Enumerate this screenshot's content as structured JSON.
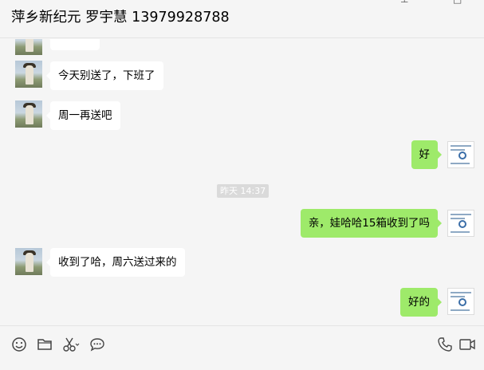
{
  "window": {
    "title": "萍乡新纪元 罗宇慧 13979928788",
    "controls": {
      "pin": "⊥",
      "minimize": "—",
      "maximize": "□"
    }
  },
  "messages": [
    {
      "side": "left",
      "text": ""
    },
    {
      "side": "left",
      "text": "今天别送了，下班了"
    },
    {
      "side": "left",
      "text": "周一再送吧"
    },
    {
      "side": "right",
      "text": "好"
    },
    {
      "side": "time",
      "text": "昨天 14:37"
    },
    {
      "side": "right",
      "text": "亲，娃哈哈15箱收到了吗"
    },
    {
      "side": "left",
      "text": "收到了哈，周六送过来的"
    },
    {
      "side": "right",
      "text": "好的"
    }
  ],
  "toolbar": {
    "left_icons": [
      "emoji-icon",
      "folder-icon",
      "scissors-icon",
      "chat-bubble-icon"
    ],
    "right_icons": [
      "phone-icon",
      "video-icon"
    ]
  },
  "colors": {
    "background": "#f5f5f5",
    "sent_bubble": "#9eea6a",
    "received_bubble": "#ffffff",
    "timestamp_bg": "#dadada"
  }
}
